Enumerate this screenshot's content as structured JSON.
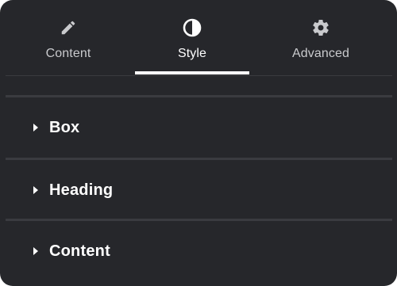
{
  "tabs": [
    {
      "label": "Content",
      "icon": "pencil-icon"
    },
    {
      "label": "Style",
      "icon": "contrast-icon"
    },
    {
      "label": "Advanced",
      "icon": "gear-icon"
    }
  ],
  "active_tab": "Style",
  "sections": [
    {
      "title": "Box"
    },
    {
      "title": "Heading"
    },
    {
      "title": "Content"
    }
  ],
  "colors": {
    "panel_bg": "#26272b",
    "active_text": "#ffffff",
    "inactive_text": "#c9cacd",
    "separator": "#3a3b40"
  }
}
